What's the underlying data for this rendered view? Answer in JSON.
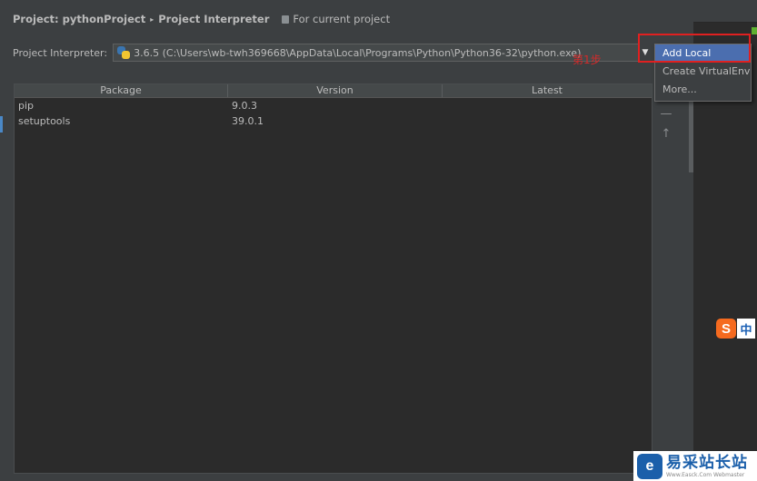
{
  "breadcrumb": {
    "project": "Project: pythonProject",
    "separator": "▸",
    "page": "Project Interpreter",
    "scope": "For current project"
  },
  "interpreter": {
    "label": "Project Interpreter:",
    "value": "3.6.5 (C:\\Users\\wb-twh369668\\AppData\\Local\\Programs\\Python\\Python36-32\\python.exe)",
    "arrow": "▼"
  },
  "annotation": {
    "text": "第1步",
    "color": "#d42a2a"
  },
  "dropdown": {
    "items": [
      {
        "label": "Add Local",
        "selected": true
      },
      {
        "label": "Create VirtualEnv",
        "selected": false
      },
      {
        "label": "More...",
        "selected": false
      }
    ]
  },
  "table": {
    "headers": [
      "Package",
      "Version",
      "Latest"
    ],
    "rows": [
      {
        "package": "pip",
        "version": "9.0.3",
        "latest": ""
      },
      {
        "package": "setuptools",
        "version": "39.0.1",
        "latest": ""
      }
    ]
  },
  "side_tools": {
    "add": "+",
    "remove": "—",
    "upgrade": "↑"
  },
  "ime": {
    "badge": "S",
    "mode": "中"
  },
  "watermark": {
    "logo": "e",
    "cn": "易采站长站",
    "en": "Www.Easck.Com Webmaster"
  },
  "colors": {
    "panel": "#3c3f41",
    "table_bg": "#2b2b2b",
    "selection": "#4b6eaf",
    "highlight_box": "#e02020"
  }
}
